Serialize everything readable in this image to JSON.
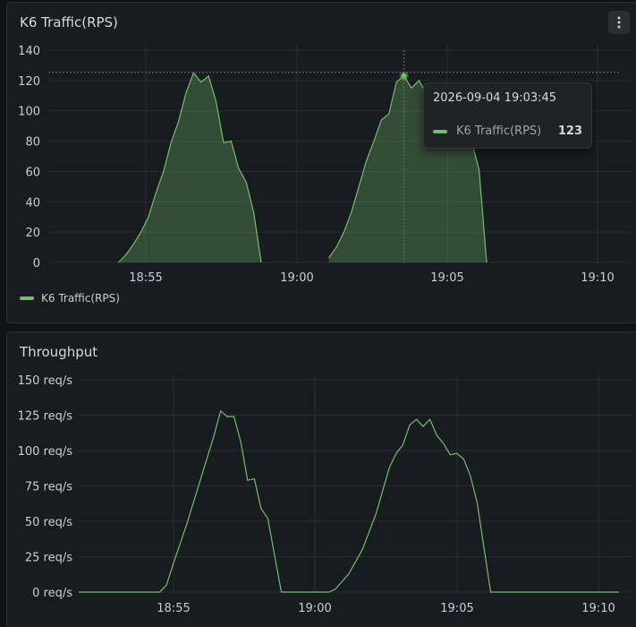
{
  "colors": {
    "series": "#73bf69",
    "grid": "#2a2c31",
    "text": "#ccccdc"
  },
  "panel_top": {
    "title": "K6 Traffic(RPS)",
    "menu_icon": "vertical-dots-icon",
    "legend": "K6 Traffic(RPS)",
    "tooltip": {
      "time": "2026-09-04 19:03:45",
      "series": "K6 Traffic(RPS)",
      "value": "123"
    }
  },
  "panel_bottom": {
    "title": "Throughput"
  },
  "chart_data": [
    {
      "type": "area",
      "title": "K6 Traffic(RPS)",
      "xlabel": "",
      "ylabel": "",
      "x_ticks": [
        "18:55",
        "19:00",
        "19:05",
        "19:10"
      ],
      "y_ticks": [
        "0",
        "20",
        "40",
        "60",
        "80",
        "100",
        "120",
        "140"
      ],
      "ylim": [
        0,
        140
      ],
      "xlim": [
        "18:51:30",
        "19:11:30"
      ],
      "grid": true,
      "legend": "bottom-left",
      "series": [
        {
          "name": "K6 Traffic(RPS)",
          "segments": [
            [
              [
                "18:54:15",
                0
              ],
              [
                "18:54:30",
                5
              ],
              [
                "18:54:45",
                12
              ],
              [
                "18:55:00",
                20
              ],
              [
                "18:55:15",
                30
              ],
              [
                "18:55:30",
                46
              ],
              [
                "18:55:45",
                60
              ],
              [
                "18:56:00",
                79
              ],
              [
                "18:56:15",
                93
              ],
              [
                "18:56:30",
                112
              ],
              [
                "18:56:45",
                125
              ],
              [
                "18:57:00",
                119
              ],
              [
                "18:57:15",
                123
              ],
              [
                "18:57:30",
                106
              ],
              [
                "18:57:45",
                79
              ],
              [
                "18:58:00",
                80
              ],
              [
                "18:58:15",
                62
              ],
              [
                "18:58:30",
                53
              ],
              [
                "18:58:45",
                33
              ],
              [
                "18:59:00",
                0
              ]
            ],
            [
              [
                "19:01:15",
                3
              ],
              [
                "19:01:30",
                10
              ],
              [
                "19:01:45",
                20
              ],
              [
                "19:02:00",
                33
              ],
              [
                "19:02:15",
                50
              ],
              [
                "19:02:30",
                67
              ],
              [
                "19:02:45",
                80
              ],
              [
                "19:03:00",
                94
              ],
              [
                "19:03:15",
                98
              ],
              [
                "19:03:30",
                119
              ],
              [
                "19:03:45",
                123
              ],
              [
                "19:04:00",
                115
              ],
              [
                "19:04:15",
                120
              ],
              [
                "19:04:30",
                111
              ],
              [
                "19:04:45",
                107
              ],
              [
                "19:05:00",
                103
              ],
              [
                "19:05:15",
                96
              ],
              [
                "19:05:30",
                96
              ],
              [
                "19:05:45",
                92
              ],
              [
                "19:06:00",
                80
              ],
              [
                "19:06:15",
                61
              ],
              [
                "19:06:30",
                0
              ]
            ]
          ]
        }
      ]
    },
    {
      "type": "line",
      "title": "Throughput",
      "xlabel": "",
      "ylabel": "",
      "x_ticks": [
        "18:55",
        "19:00",
        "19:05",
        "19:10"
      ],
      "y_ticks": [
        "0 req/s",
        "25 req/s",
        "50 req/s",
        "75 req/s",
        "100 req/s",
        "125 req/s",
        "150 req/s"
      ],
      "ylim": [
        0,
        150
      ],
      "xlim": [
        "18:51:30",
        "19:11:30"
      ],
      "grid": true,
      "series": [
        {
          "name": "Throughput",
          "points": [
            [
              "18:51:30",
              0
            ],
            [
              "18:54:30",
              0
            ],
            [
              "18:54:45",
              5
            ],
            [
              "18:55:00",
              20
            ],
            [
              "18:55:30",
              48
            ],
            [
              "18:56:00",
              79
            ],
            [
              "18:56:30",
              110
            ],
            [
              "18:56:45",
              128
            ],
            [
              "18:57:00",
              124
            ],
            [
              "18:57:15",
              124
            ],
            [
              "18:57:30",
              106
            ],
            [
              "18:57:45",
              79
            ],
            [
              "18:58:00",
              80
            ],
            [
              "18:58:15",
              59
            ],
            [
              "18:58:30",
              52
            ],
            [
              "18:59:00",
              0
            ],
            [
              "19:00:45",
              0
            ],
            [
              "19:01:00",
              2
            ],
            [
              "19:01:30",
              13
            ],
            [
              "19:02:00",
              30
            ],
            [
              "19:02:30",
              55
            ],
            [
              "19:03:00",
              88
            ],
            [
              "19:03:15",
              98
            ],
            [
              "19:03:30",
              104
            ],
            [
              "19:03:45",
              118
            ],
            [
              "19:04:00",
              122
            ],
            [
              "19:04:15",
              117
            ],
            [
              "19:04:30",
              122
            ],
            [
              "19:04:45",
              111
            ],
            [
              "19:05:00",
              105
            ],
            [
              "19:05:15",
              97
            ],
            [
              "19:05:30",
              98
            ],
            [
              "19:05:45",
              94
            ],
            [
              "19:06:00",
              82
            ],
            [
              "19:06:15",
              63
            ],
            [
              "19:06:45",
              0
            ],
            [
              "19:11:30",
              0
            ]
          ]
        }
      ]
    }
  ]
}
